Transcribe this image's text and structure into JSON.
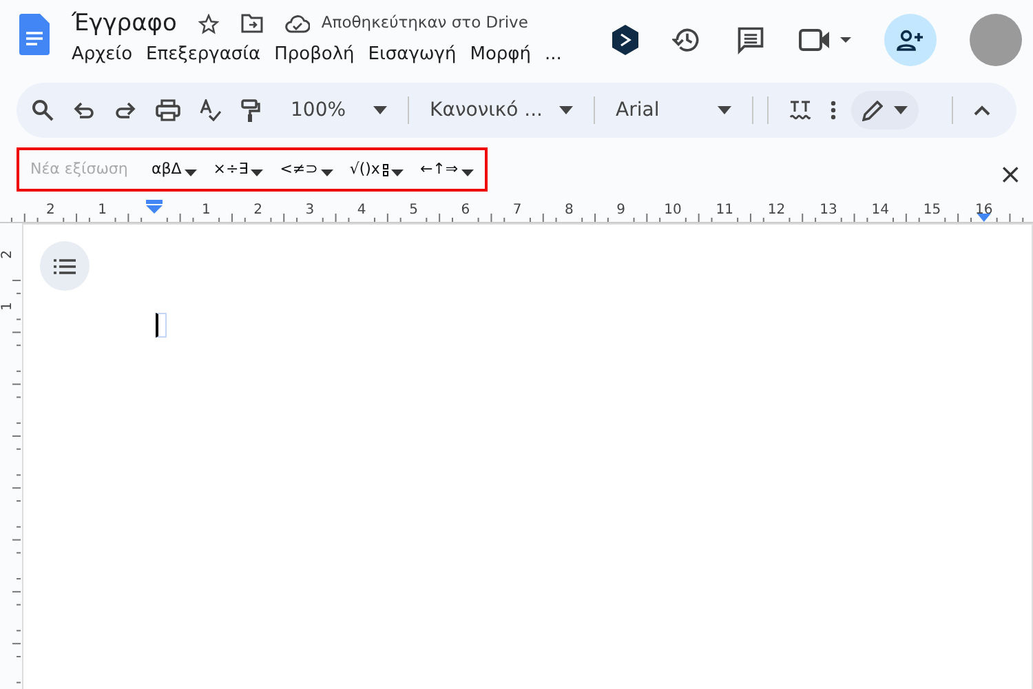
{
  "window": {
    "title": "Έγγραφο",
    "save_status": "Αποθηκεύτηκαν στο Drive"
  },
  "menus": [
    {
      "label": "Αρχείο"
    },
    {
      "label": "Επεξεργασία"
    },
    {
      "label": "Προβολή"
    },
    {
      "label": "Εισαγωγή"
    },
    {
      "label": "Μορφή"
    },
    {
      "label": "..."
    }
  ],
  "toolbar": {
    "zoom": "100%",
    "style": "Κανονικό ...",
    "font": "Arial"
  },
  "equation_bar": {
    "placeholder": "Νέα εξίσωση",
    "symbol_groups": [
      "αβΔ",
      "×÷∃",
      "<≠⊃",
      "√()x",
      "←↑⇒"
    ],
    "close": "×"
  },
  "ruler": {
    "left_labels": [
      "2",
      "1"
    ],
    "right_labels": [
      "1",
      "2",
      "3",
      "4",
      "5",
      "6",
      "7",
      "8",
      "9",
      "10",
      "11",
      "12",
      "13",
      "14",
      "15",
      "16"
    ],
    "vertical_labels": [
      "2",
      "1"
    ]
  }
}
